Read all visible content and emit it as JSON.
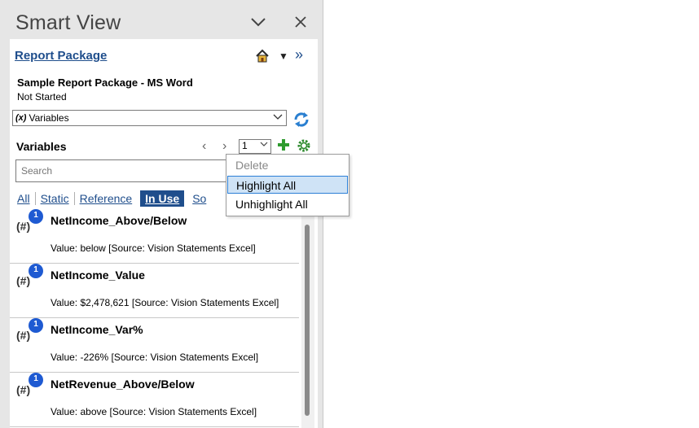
{
  "pane": {
    "title": "Smart View",
    "collapse_icon": "chevron-down-icon",
    "close_icon": "close-icon"
  },
  "report_package": {
    "link_label": "Report Package",
    "name": "Sample Report Package - MS Word",
    "status": "Not Started"
  },
  "view_dropdown": {
    "prefix": "(x)",
    "value": "Variables"
  },
  "variables_section": {
    "title": "Variables",
    "page_value": "1",
    "search_placeholder": "Search"
  },
  "filters": [
    {
      "label": "All"
    },
    {
      "label": "Static"
    },
    {
      "label": "Reference"
    },
    {
      "label": "In Use",
      "active": true
    },
    {
      "label": "So"
    }
  ],
  "variables": [
    {
      "badge": "1",
      "icon": "(#)",
      "name": "NetIncome_Above/Below",
      "value": "Value: below [Source: Vision Statements Excel]"
    },
    {
      "badge": "1",
      "icon": "(#)",
      "name": "NetIncome_Value",
      "value": "Value:  $2,478,621  [Source: Vision Statements Excel]"
    },
    {
      "badge": "1",
      "icon": "(#)",
      "name": "NetIncome_Var%",
      "value": "Value: -226% [Source: Vision Statements Excel]"
    },
    {
      "badge": "1",
      "icon": "(#)",
      "name": "NetRevenue_Above/Below",
      "value": "Value: above [Source: Vision Statements Excel]"
    }
  ],
  "context_menu": {
    "items": [
      {
        "label": "Delete",
        "enabled": false
      },
      {
        "label": "Highlight All",
        "enabled": true,
        "highlighted": true
      },
      {
        "label": "Unhighlight All",
        "enabled": true
      }
    ]
  },
  "colors": {
    "accent": "#1f4e8c",
    "badge": "#1e5ad2",
    "menu_highlight": "#cfe3f6"
  }
}
